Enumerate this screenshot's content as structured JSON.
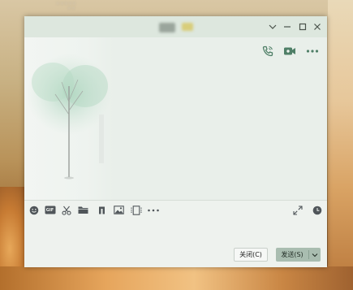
{
  "desktop": {
    "icon_label_line1": "· · · · ·",
    "icon_label_line2": "· ·"
  },
  "window": {
    "title_icons": {
      "minimize_dropdown": "chevron-down-icon",
      "minimize": "minimize-icon",
      "maximize": "maximize-icon",
      "close": "close-icon"
    },
    "actions": [
      "phone-call-icon",
      "video-call-icon",
      "more-icon"
    ],
    "toolbar": [
      "emoji-icon",
      "gif-icon",
      "scissors-icon",
      "folder-icon",
      "music-icon",
      "image-icon",
      "screen-record-icon",
      "more-icon"
    ],
    "toolbar_right": [
      "expand-icon",
      "history-icon"
    ],
    "gif_text": "GIF",
    "buttons": {
      "close_label": "关闭(C)",
      "send_label": "发送(S)"
    }
  },
  "colors": {
    "accent": "#a9bdb0",
    "action_icon": "#4f7f67",
    "window_bg": "#eef2ee"
  }
}
